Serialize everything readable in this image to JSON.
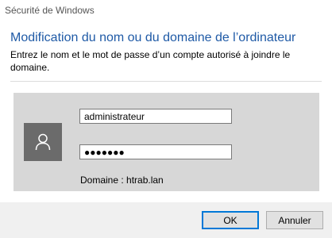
{
  "window": {
    "title": "Sécurité de Windows"
  },
  "dialog": {
    "heading": "Modification du nom ou du domaine de l’ordinateur",
    "instructions": "Entrez le nom et le mot de passe d’un compte autorisé à joindre le domaine."
  },
  "credentials": {
    "avatar_icon": "user-icon",
    "username_value": "administrateur",
    "password_value": "●●●●●●●",
    "domain_text": "Domaine : htrab.lan"
  },
  "buttons": {
    "ok_label": "OK",
    "cancel_label": "Annuler"
  },
  "colors": {
    "heading": "#1f5aa6",
    "panel": "#d7d7d7",
    "avatar": "#6b6b6b",
    "footer": "#f0f0f0",
    "default_button_border": "#0078d7"
  }
}
